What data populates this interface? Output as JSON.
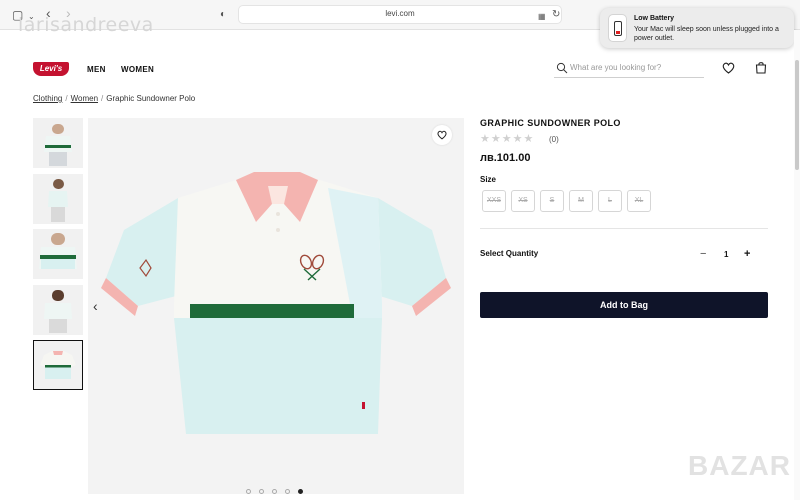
{
  "browser": {
    "url": "levi.com",
    "watermark": "larisandreeva"
  },
  "notification": {
    "title": "Low Battery",
    "body": "Your Mac will sleep soon unless plugged into a power outlet."
  },
  "header": {
    "logo": "Levi's",
    "nav": [
      "MEN",
      "WOMEN"
    ],
    "search_placeholder": "What are you looking for?"
  },
  "breadcrumb": {
    "items": [
      "Clothing",
      "Women"
    ],
    "current": "Graphic Sundowner Polo"
  },
  "product": {
    "title": "GRAPHIC SUNDOWNER POLO",
    "rating": 0,
    "review_count": "(0)",
    "price": "лв.101.00",
    "size_label": "Size",
    "sizes": [
      "XXS",
      "XS",
      "S",
      "M",
      "L",
      "XL"
    ],
    "quantity_label": "Select Quantity",
    "quantity_minus": "−",
    "quantity": "1",
    "quantity_plus": "+",
    "add_to_bag": "Add to Bag"
  },
  "gallery": {
    "image_count": 5,
    "active_index": 4
  },
  "colors": {
    "brand_red": "#c41230",
    "button_navy": "#0f1429",
    "polo_mint": "#d8f0f0",
    "polo_pink": "#f4b4b0",
    "polo_green": "#1f6b3a"
  },
  "site_watermark": "BAZAR"
}
